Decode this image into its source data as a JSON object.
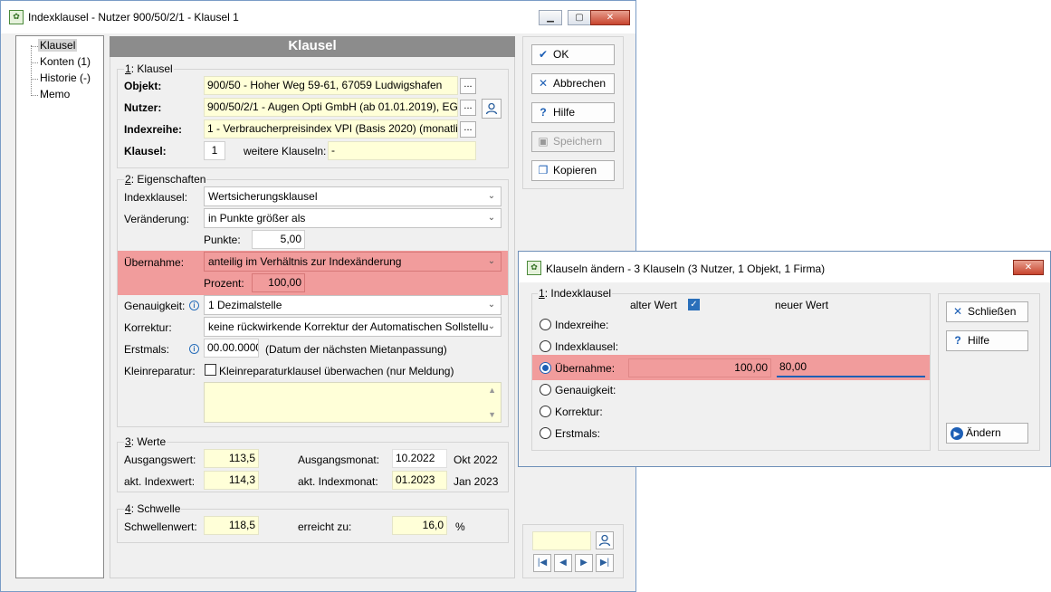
{
  "main_window": {
    "title": "Indexklausel - Nutzer 900/50/2/1 - Klausel 1",
    "tree": {
      "items": [
        "Klausel",
        "Konten (1)",
        "Historie (-)",
        "Memo"
      ]
    },
    "header": "Klausel",
    "group1": {
      "title_prefix": "1",
      "title_rest": ": Klausel",
      "objekt_label": "Objekt:",
      "objekt_value": "900/50 - Hoher Weg 59-61, 67059 Ludwigshafen",
      "nutzer_label": "Nutzer:",
      "nutzer_value": "900/50/2/1 - Augen Opti GmbH  (ab 01.01.2019), EG",
      "indexreihe_label": "Indexreihe:",
      "indexreihe_value": "1 - Verbraucherpreisindex VPI (Basis 2020)  (monatlic",
      "klausel_label": "Klausel:",
      "klausel_value": "1",
      "weitere_label": "weitere Klauseln:",
      "weitere_value": "-",
      "dots": "..."
    },
    "group2": {
      "title_prefix": "2",
      "title_rest": ": Eigenschaften",
      "indexklausel_label": "Indexklausel:",
      "indexklausel_value": "Wertsicherungsklausel",
      "veraenderung_label": "Veränderung:",
      "veraenderung_value": "in Punkte größer als",
      "punkte_label": "Punkte:",
      "punkte_value": "5,00",
      "uebernahme_label": "Übernahme:",
      "uebernahme_value": "anteilig im Verhältnis zur Indexänderung",
      "prozent_label": "Prozent:",
      "prozent_value": "100,00",
      "genauigkeit_label": "Genauigkeit:",
      "genauigkeit_value": "1 Dezimalstelle",
      "korrektur_label": "Korrektur:",
      "korrektur_value": "keine rückwirkende Korrektur der Automatischen Sollstellu",
      "erstmals_label": "Erstmals:",
      "erstmals_value": "00.00.0000",
      "erstmals_note": "(Datum der nächsten Mietanpassung)",
      "kleinreparatur_label": "Kleinreparatur:",
      "kleinreparatur_checkbox": "Kleinreparaturklausel überwachen (nur Meldung)"
    },
    "group3": {
      "title_prefix": "3",
      "title_rest": ": Werte",
      "ausgangswert_label": "Ausgangswert:",
      "ausgangswert_value": "113,5",
      "ausgangsmonat_label": "Ausgangsmonat:",
      "ausgangsmonat_value": "10.2022",
      "ausgangsmonat_text": "Okt 2022",
      "akt_indexwert_label": "akt. Indexwert:",
      "akt_indexwert_value": "114,3",
      "akt_indexmonat_label": "akt. Indexmonat:",
      "akt_indexmonat_value": "01.2023",
      "akt_indexmonat_text": "Jan 2023"
    },
    "group4": {
      "title_prefix": "4",
      "title_rest": ": Schwelle",
      "schwellenwert_label": "Schwellenwert:",
      "schwellenwert_value": "118,5",
      "erreicht_label": "erreicht zu:",
      "erreicht_value": "16,0",
      "erreicht_unit": "%"
    },
    "buttons": {
      "ok": "OK",
      "abbrechen": "Abbrechen",
      "hilfe": "Hilfe",
      "speichern": "Speichern",
      "kopieren": "Kopieren"
    }
  },
  "dialog": {
    "title": "Klauseln ändern - 3 Klauseln (3 Nutzer, 1 Objekt, 1 Firma)",
    "group_prefix": "1",
    "group_rest": ": Indexklausel",
    "alter_wert": "alter Wert",
    "neuer_wert": "neuer Wert",
    "options": [
      "Indexreihe:",
      "Indexklausel:",
      "Übernahme:",
      "Genauigkeit:",
      "Korrektur:",
      "Erstmals:"
    ],
    "old_value": "100,00",
    "new_value": "80,00",
    "buttons": {
      "schliessen": "Schließen",
      "hilfe": "Hilfe",
      "aendern": "Ändern"
    }
  }
}
